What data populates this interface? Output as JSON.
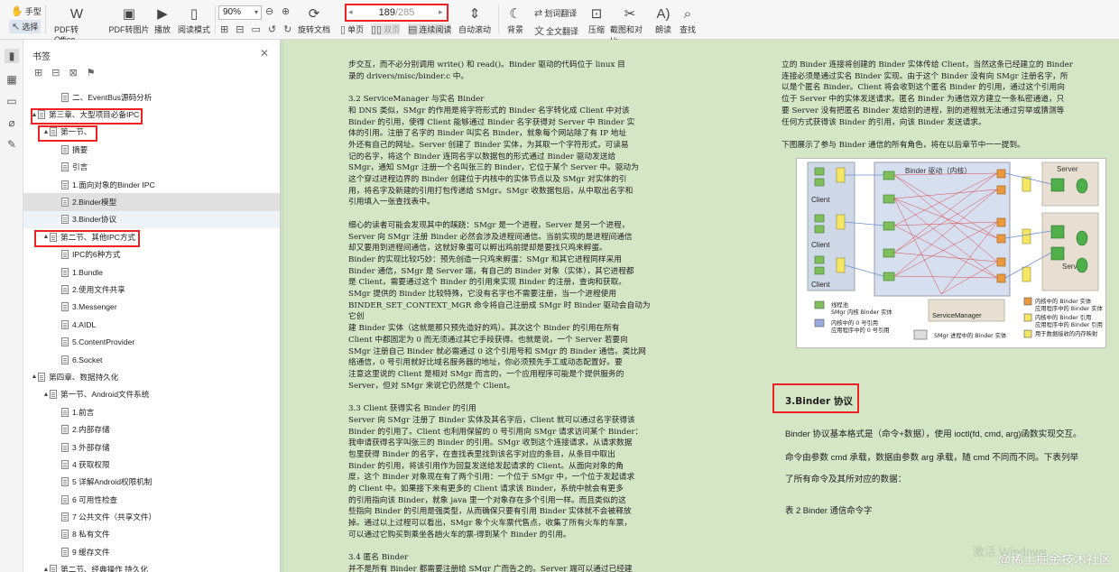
{
  "toolbar": {
    "hand_label": "手型",
    "select_label": "选择",
    "pdf_to_office": "PDF转Office",
    "pdf_to_image": "PDF转图片",
    "play": "播放",
    "read_mode": "阅读模式",
    "zoom_value": "90%",
    "rotate_doc": "旋转文档",
    "single_page": "单页",
    "double_page": "双页",
    "continuous": "连续阅读",
    "auto_scroll": "自动滚动",
    "background": "背景",
    "word_translate": "划词翻译",
    "full_translate": "全文翻译",
    "compress": "压缩",
    "screenshot_compare": "截图和对比",
    "read_aloud": "朗读",
    "search": "查找",
    "page_current": "189",
    "page_total": "/285"
  },
  "bookmarks": {
    "title": "书签",
    "items": [
      {
        "label": "二、EventBus源码分析",
        "level": 2,
        "toggle": ""
      },
      {
        "label": "第三章、大型项目必备IPC",
        "level": 0,
        "toggle": "▲"
      },
      {
        "label": "第一节、",
        "level": 1,
        "toggle": "▲"
      },
      {
        "label": "摘要",
        "level": 2,
        "toggle": ""
      },
      {
        "label": "引言",
        "level": 2,
        "toggle": ""
      },
      {
        "label": "1.面向对象的Binder IPC",
        "level": 2,
        "toggle": ""
      },
      {
        "label": "2.Binder模型",
        "level": 2,
        "toggle": ""
      },
      {
        "label": "3.Binder协议",
        "level": 2,
        "toggle": ""
      },
      {
        "label": "第二节、其他IPC方式",
        "level": 1,
        "toggle": "▲"
      },
      {
        "label": "IPC的6种方式",
        "level": 2,
        "toggle": ""
      },
      {
        "label": "1.Bundle",
        "level": 2,
        "toggle": ""
      },
      {
        "label": "2.使用文件共享",
        "level": 2,
        "toggle": ""
      },
      {
        "label": "3.Messenger",
        "level": 2,
        "toggle": ""
      },
      {
        "label": "4.AIDL",
        "level": 2,
        "toggle": ""
      },
      {
        "label": "5.ContentProvider",
        "level": 2,
        "toggle": ""
      },
      {
        "label": "6.Socket",
        "level": 2,
        "toggle": ""
      },
      {
        "label": "第四章、数据持久化",
        "level": 0,
        "toggle": "▲"
      },
      {
        "label": "第一节、Android文件系统",
        "level": 1,
        "toggle": "▲"
      },
      {
        "label": "1.前言",
        "level": 2,
        "toggle": ""
      },
      {
        "label": "2.内部存储",
        "level": 2,
        "toggle": ""
      },
      {
        "label": "3 外部存储",
        "level": 2,
        "toggle": ""
      },
      {
        "label": "4 获取权限",
        "level": 2,
        "toggle": ""
      },
      {
        "label": "5 详解Android权限机制",
        "level": 2,
        "toggle": ""
      },
      {
        "label": "6 可用性检查",
        "level": 2,
        "toggle": ""
      },
      {
        "label": "7 公共文件（共享文件）",
        "level": 2,
        "toggle": ""
      },
      {
        "label": "8 私有文件",
        "level": 2,
        "toggle": ""
      },
      {
        "label": "9 缓存文件",
        "level": 2,
        "toggle": ""
      },
      {
        "label": "第二节、经典操作 持久化",
        "level": 1,
        "toggle": "▲"
      }
    ]
  },
  "doc": {
    "col1": [
      "步交互，而不必分别调用 write() 和 read()。Binder 驱动的代码位于 linux 目",
      "录的 drivers/misc/binder.c 中。",
      "",
      "3.2 ServiceManager 与实名 Binder",
      "和 DNS 类似，SMgr 的作用是将字符形式的 Binder 名字转化成 Client 中对该",
      "Binder 的引用，使得 Client 能够通过 Binder 名字获得对 Server 中 Binder 实",
      "体的引用。注册了名字的 Binder 叫实名 Binder，就象每个网站除了有 IP 地址",
      "外还有自己的网址。Server 创建了 Binder 实体，为其取一个字符形式，可读易",
      "记的名字，将这个 Binder 连同名字以数据包的形式通过 Binder 驱动发送给",
      "SMgr，通知 SMgr 注册一个名叫张三的 Binder，它位于某个 Server 中。驱动为",
      "这个穿过进程边界的 Binder 创建位于内核中的实体节点以及 SMgr 对实体的引",
      "用，将名字及新建的引用打包传递给 SMgr。SMgr 收数据包后，从中取出名字和",
      "引用填入一张查找表中。",
      "",
      "细心的读者可能会发现其中的蹊跷：SMgr 是一个进程，Server 是另一个进程，",
      "Server 向 SMgr 注册 Binder 必然会涉及进程间通信。当前实现的是进程间通信",
      "却又要用到进程间通信，这就好象蛋可以孵出鸡前提却是要找只鸡来孵蛋。",
      "Binder 的实现比较巧妙：预先创造一只鸡来孵蛋：SMgr 和其它进程同样采用",
      "Binder 通信，SMgr 是 Server 端，有自己的 Binder 对象（实体），其它进程都",
      "是 Client，需要通过这个 Binder 的引用来实现 Binder 的注册，查询和获取。",
      "SMgr 提供的 Binder 比较特殊，它没有名字也不需要注册，当一个进程使用",
      "BINDER_SET_CONTEXT_MGR 命令将自己注册成 SMgr 时 Binder 驱动会自动为它创",
      "建 Binder 实体（这就是那只预先造好的鸡）。其次这个 Binder 的引用在所有",
      "Client 中都固定为 0 而无须通过其它手段获得。也就是说，一个 Server 若要向",
      "SMgr 注册自己 Binder 就必需通过 0 这个引用号和 SMgr 的 Binder 通信。类比网",
      "络通信，0 号引用就好比域名服务器的地址，你必须预先手工或动态配置好。要",
      "注意这里说的 Client 是相对 SMgr 而言的，一个应用程序可能是个提供服务的",
      "Server，但对 SMgr 来说它仍然是个 Client。",
      "",
      "3.3 Client 获得实名 Binder 的引用",
      "Server 向 SMgr 注册了 Binder 实体及其名字后，Client 就可以通过名字获得该",
      "Binder 的引用了。Client 也利用保留的 0 号引用向 SMgr 请求访问某个 Binder：",
      "我申请获得名字叫张三的 Binder 的引用。SMgr 收到这个连接请求，从请求数据",
      "包里获得 Binder 的名字，在查找表里找到该名字对应的条目，从条目中取出",
      "Binder 的引用，将该引用作为回复发送给发起请求的 Client。从面向对象的角",
      "度，这个 Binder 对象现在有了两个引用：一个位于 SMgr 中，一个位于发起请求",
      "的 Client 中。如果接下来有更多的 Client 请求该 Binder，系统中就会有更多",
      "的引用指向该 Binder，就象 java 里一个对象存在多个引用一样。而且类似的这",
      "些指向 Binder 的引用是强类型，从而确保只要有引用 Binder 实体就不会被释放",
      "掉。通过以上过程可以看出，SMgr 象个火车票代售点，收集了所有火车的车票，",
      "可以通过它购买到乘坐各趟火车的票-得到某个 Binder 的引用。",
      "",
      "3.4 匿名 Binder",
      "并不是所有 Binder 都需要注册给 SMgr 广而告之的。Server 端可以通过已经建"
    ],
    "col2": [
      "立的 Binder 连接将创建的 Binder 实体传给 Client，当然这条已经建立的 Binder",
      "连接必须是通过实名 Binder 实现。由于这个 Binder 没有向 SMgr 注册名字，所",
      "以是个匿名 Binder。Client 将会收到这个匿名 Binder 的引用，通过这个引用向",
      "位于 Server 中的实体发送请求。匿名 Binder 为通信双方建立一条私密通道，只",
      "要 Server 没有把匿名 Binder 发给别的进程，别的进程就无法通过穷举或猜测等",
      "任何方式获得该 Binder 的引用，向该 Binder 发送请求。",
      "",
      "下图展示了参与 Binder 通信的所有角色，将在以后章节中一一提到。"
    ],
    "figure": {
      "driver_label": "Binder 驱动（内核）",
      "client_label": "Client",
      "server_label": "Server",
      "service_manager_label": "ServiceManager",
      "legend_thread": "线程池",
      "legend_smgr_entity": "SMgr 内核 Binder 实体",
      "legend_ref0": "内核中的 0 号引用",
      "legend_app_ref0": "应用程序中的 0 号引用",
      "legend_smgr_process": "SMgr 进程中的 Binder 实体",
      "legend_kernel_entity": "内核中的 Binder 实体",
      "legend_app_entity": "应用程序中的 Binder 实体",
      "legend_kernel_ref": "内核中的 Binder 引用",
      "legend_app_ref": "应用程序中的 Binder 引用",
      "legend_shared_mem": "用于数据接收的内存映射"
    },
    "section3_title": "3.Binder 协议",
    "body3_line1": "Binder 协议基本格式是（命令+数据），使用 ioctl(fd, cmd, arg)函数实现交互。",
    "body3_line2": "命令由参数 cmd 承载，数据由参数 arg 承载，随 cmd 不同而不同。下表列举",
    "body3_line3": "了所有命令及其所对应的数据：",
    "table_caption": "表 2 Binder 通信命令字"
  },
  "watermark": "@稀土掘金技术社区",
  "win_activate": "激活 Windows"
}
